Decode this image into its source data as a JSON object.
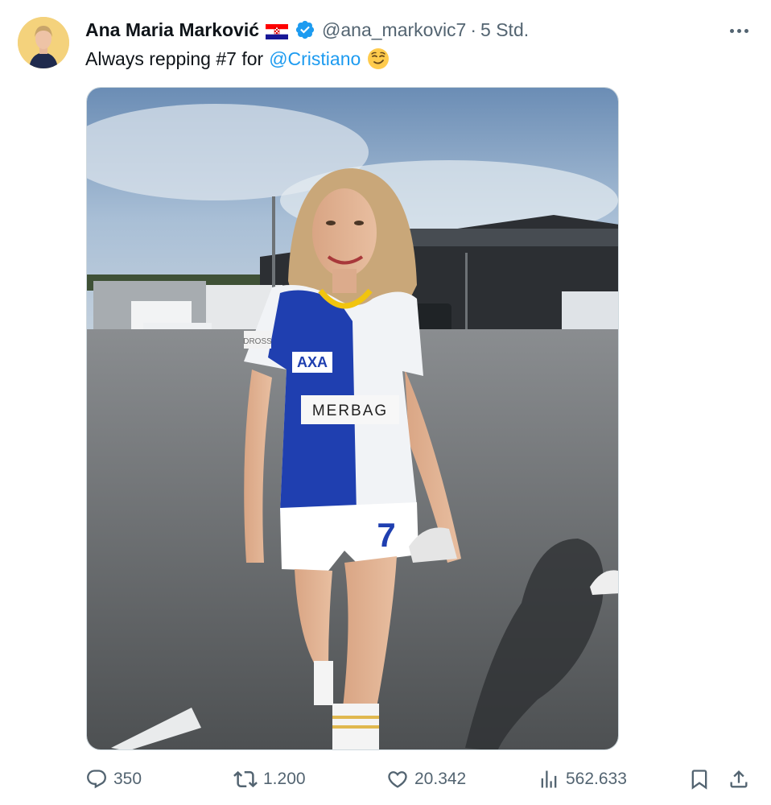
{
  "author": {
    "name": "Ana Maria Marković",
    "handle": "@ana_markovic7",
    "separator": "·",
    "time": "5 Std.",
    "flag_icon": "croatia-flag-icon",
    "verified_icon": "verified-badge-icon"
  },
  "tweet": {
    "text": "Always repping #7 for",
    "mention": "@Cristiano",
    "emoji": "smirking-face-emoji"
  },
  "media": {
    "description_icon": "photo",
    "jersey_sponsor_1": "AXA",
    "jersey_sponsor_2": "MERBAG",
    "shorts_number": "7",
    "banner_text": "DROSS"
  },
  "actions": {
    "replies": "350",
    "reposts": "1.200",
    "likes": "20.342",
    "views": "562.633"
  },
  "colors": {
    "accent": "#1d9bf0",
    "secondary_text": "#536471",
    "primary_text": "#0f1419"
  }
}
